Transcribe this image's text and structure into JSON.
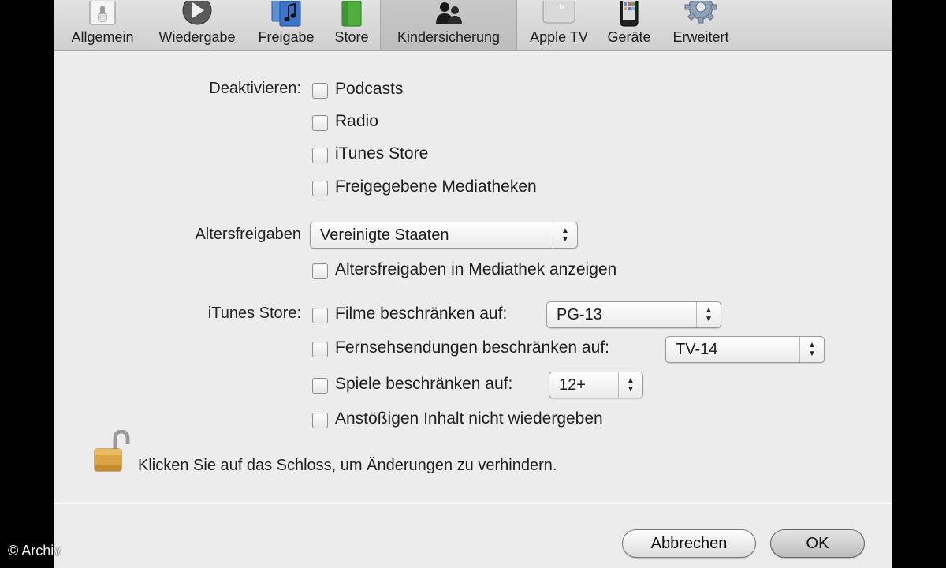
{
  "toolbar": {
    "items": [
      {
        "label": "Allgemein",
        "icon": "switch-icon"
      },
      {
        "label": "Wiedergabe",
        "icon": "play-icon"
      },
      {
        "label": "Freigabe",
        "icon": "music-note-icon"
      },
      {
        "label": "Store",
        "icon": "shopping-bag-icon"
      },
      {
        "label": "Kindersicherung",
        "icon": "parents-icon",
        "selected": true
      },
      {
        "label": "Apple TV",
        "icon": "apple-tv-icon"
      },
      {
        "label": "Geräte",
        "icon": "device-icon"
      },
      {
        "label": "Erweitert",
        "icon": "gear-icon"
      }
    ]
  },
  "disable": {
    "label": "Deaktivieren:",
    "options": [
      {
        "label": "Podcasts",
        "checked": false
      },
      {
        "label": "Radio",
        "checked": false
      },
      {
        "label": "iTunes Store",
        "checked": false
      },
      {
        "label": "Freigegebene Mediatheken",
        "checked": false
      }
    ]
  },
  "ratings": {
    "label": "Altersfreigaben",
    "selected": "Vereinigte Staaten",
    "show_in_library": {
      "label": "Altersfreigaben in Mediathek anzeigen",
      "checked": false
    }
  },
  "itunes_store": {
    "label": "iTunes Store:",
    "movies": {
      "label": "Filme beschränken auf:",
      "checked": false,
      "selected": "PG-13"
    },
    "tv": {
      "label": "Fernsehsendungen beschränken auf:",
      "checked": false,
      "selected": "TV-14"
    },
    "games": {
      "label": "Spiele beschränken auf:",
      "checked": false,
      "selected": "12+"
    },
    "explicit": {
      "label": "Anstößigen Inhalt nicht wiedergeben",
      "checked": false
    }
  },
  "lock": {
    "text": "Klicken Sie auf das Schloss, um Änderungen zu verhindern.",
    "icon": "open-lock-icon"
  },
  "buttons": {
    "cancel": "Abbrechen",
    "ok": "OK"
  },
  "watermark": "© Archiv",
  "colors": {
    "window_bg": "#ececec",
    "outer_bg": "#000000",
    "lock_gold": "#d9a441"
  }
}
